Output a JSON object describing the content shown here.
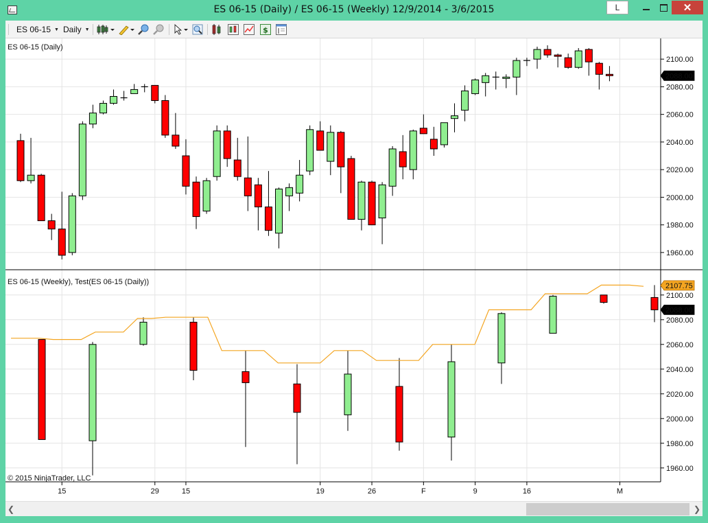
{
  "window": {
    "title": "ES 06-15 (Daily) / ES 06-15 (Weekly)  12/9/2014 - 3/6/2015",
    "l_button": "L",
    "close_glyph": "✕"
  },
  "toolbar": {
    "instrument": "ES 06-15",
    "interval": "Daily",
    "icons": [
      "chart-style-icon",
      "drawing-tool-icon",
      "zoom-in-icon",
      "zoom-out-icon",
      "pointer-icon",
      "magnifier-icon",
      "data-series-icon",
      "indicators-icon",
      "strategies-icon",
      "dollar-icon",
      "properties-icon"
    ]
  },
  "colors": {
    "up": "#90ee90",
    "down": "#ff0000",
    "outline": "#000000",
    "indicator_line": "#f4a521",
    "indicator_label_bg": "#f4a521",
    "last_price_bg": "#000000",
    "grid": "#e4e4e4"
  },
  "chart_data": [
    {
      "type": "candlestick",
      "panel": "top",
      "title": "ES 06-15 (Daily)",
      "y_ticks": [
        1960,
        1980,
        2000,
        2020,
        2040,
        2060,
        2080,
        2100
      ],
      "y_tick_labels": [
        "1960.00",
        "1980.00",
        "2000.00",
        "2020.00",
        "2040.00",
        "2060.00",
        "2080.00",
        "2100.00"
      ],
      "ylim": [
        1951,
        2112
      ],
      "last_price": "2088.00",
      "last_price_value": 2088,
      "grid": true,
      "candles": [
        {
          "o": 2041,
          "h": 2046,
          "l": 2011,
          "c": 2012
        },
        {
          "o": 2012,
          "h": 2043,
          "l": 2010,
          "c": 2016
        },
        {
          "o": 2016,
          "h": 2017,
          "l": 1983,
          "c": 1983
        },
        {
          "o": 1983,
          "h": 1988,
          "l": 1969,
          "c": 1977
        },
        {
          "o": 1977,
          "h": 2004,
          "l": 1955,
          "c": 1958
        },
        {
          "o": 1960,
          "h": 2003,
          "l": 1958,
          "c": 2001
        },
        {
          "o": 2001,
          "h": 2055,
          "l": 1998,
          "c": 2053
        },
        {
          "o": 2053,
          "h": 2067,
          "l": 2050,
          "c": 2061
        },
        {
          "o": 2061,
          "h": 2070,
          "l": 2060,
          "c": 2068
        },
        {
          "o": 2068,
          "h": 2078,
          "l": 2067,
          "c": 2073
        },
        {
          "o": 2072,
          "h": 2077,
          "l": 2070,
          "c": 2072
        },
        {
          "o": 2075,
          "h": 2082,
          "l": 2075,
          "c": 2078
        },
        {
          "o": 2080,
          "h": 2082,
          "l": 2076,
          "c": 2080
        },
        {
          "o": 2081,
          "h": 2081,
          "l": 2068,
          "c": 2070
        },
        {
          "o": 2070,
          "h": 2074,
          "l": 2043,
          "c": 2045
        },
        {
          "o": 2045,
          "h": 2061,
          "l": 2035,
          "c": 2037
        },
        {
          "o": 2030,
          "h": 2042,
          "l": 2002,
          "c": 2008
        },
        {
          "o": 2011,
          "h": 2015,
          "l": 1977,
          "c": 1986
        },
        {
          "o": 1990,
          "h": 2014,
          "l": 1988,
          "c": 2012
        },
        {
          "o": 2015,
          "h": 2052,
          "l": 2012,
          "c": 2048
        },
        {
          "o": 2048,
          "h": 2052,
          "l": 2022,
          "c": 2028
        },
        {
          "o": 2027,
          "h": 2043,
          "l": 2012,
          "c": 2015
        },
        {
          "o": 2014,
          "h": 2044,
          "l": 1990,
          "c": 2001
        },
        {
          "o": 2009,
          "h": 2014,
          "l": 1976,
          "c": 1993
        },
        {
          "o": 1993,
          "h": 2019,
          "l": 1972,
          "c": 1976
        },
        {
          "o": 1974,
          "h": 2007,
          "l": 1963,
          "c": 2006
        },
        {
          "o": 2001,
          "h": 2010,
          "l": 1990,
          "c": 2007
        },
        {
          "o": 2003,
          "h": 2027,
          "l": 1997,
          "c": 2016
        },
        {
          "o": 2019,
          "h": 2052,
          "l": 2016,
          "c": 2049
        },
        {
          "o": 2048,
          "h": 2055,
          "l": 2035,
          "c": 2034
        },
        {
          "o": 2026,
          "h": 2052,
          "l": 2016,
          "c": 2047
        },
        {
          "o": 2047,
          "h": 2048,
          "l": 2003,
          "c": 2022
        },
        {
          "o": 2028,
          "h": 2030,
          "l": 1984,
          "c": 1984
        },
        {
          "o": 1984,
          "h": 2012,
          "l": 1976,
          "c": 2011
        },
        {
          "o": 2011,
          "h": 2012,
          "l": 1980,
          "c": 1980
        },
        {
          "o": 1985,
          "h": 2011,
          "l": 1966,
          "c": 2009
        },
        {
          "o": 2008,
          "h": 2037,
          "l": 2001,
          "c": 2035
        },
        {
          "o": 2033,
          "h": 2045,
          "l": 2013,
          "c": 2022
        },
        {
          "o": 2020,
          "h": 2049,
          "l": 2013,
          "c": 2048
        },
        {
          "o": 2050,
          "h": 2060,
          "l": 2046,
          "c": 2046
        },
        {
          "o": 2042,
          "h": 2051,
          "l": 2030,
          "c": 2035
        },
        {
          "o": 2038,
          "h": 2054,
          "l": 2036,
          "c": 2054
        },
        {
          "o": 2057,
          "h": 2068,
          "l": 2047,
          "c": 2059
        },
        {
          "o": 2063,
          "h": 2081,
          "l": 2055,
          "c": 2077
        },
        {
          "o": 2075,
          "h": 2086,
          "l": 2074,
          "c": 2085
        },
        {
          "o": 2083,
          "h": 2090,
          "l": 2073,
          "c": 2088
        },
        {
          "o": 2087,
          "h": 2091,
          "l": 2078,
          "c": 2087
        },
        {
          "o": 2086,
          "h": 2089,
          "l": 2079,
          "c": 2087
        },
        {
          "o": 2087,
          "h": 2101,
          "l": 2074,
          "c": 2099
        },
        {
          "o": 2099,
          "h": 2101,
          "l": 2095,
          "c": 2099
        },
        {
          "o": 2100,
          "h": 2109,
          "l": 2093,
          "c": 2107
        },
        {
          "o": 2107,
          "h": 2110,
          "l": 2101,
          "c": 2103
        },
        {
          "o": 2103,
          "h": 2104,
          "l": 2094,
          "c": 2102
        },
        {
          "o": 2101,
          "h": 2104,
          "l": 2093,
          "c": 2094
        },
        {
          "o": 2094,
          "h": 2108,
          "l": 2093,
          "c": 2106
        },
        {
          "o": 2107,
          "h": 2108,
          "l": 2088,
          "c": 2098
        },
        {
          "o": 2097,
          "h": 2098,
          "l": 2078,
          "c": 2089
        },
        {
          "o": 2089,
          "h": 2095,
          "l": 2084,
          "c": 2088
        }
      ]
    },
    {
      "type": "candlestick",
      "panel": "bottom",
      "title": "ES 06-15 (Weekly), Test(ES 06-15 (Daily))",
      "y_ticks": [
        1960,
        1980,
        2000,
        2020,
        2040,
        2060,
        2080,
        2100
      ],
      "y_tick_labels": [
        "1960.00",
        "1980.00",
        "2000.00",
        "2020.00",
        "2040.00",
        "2060.00",
        "2080.00",
        "2100.00"
      ],
      "ylim": [
        1951,
        2116
      ],
      "last_price": "2088.00",
      "last_price_value": 2088,
      "indicator_label": "2107.75",
      "indicator_value": 2107.75,
      "grid": true,
      "candles": [
        {
          "o": 2064,
          "h": 2064,
          "l": 1983,
          "c": 1983
        },
        {
          "o": 1982,
          "h": 2062,
          "l": 1954,
          "c": 2060
        },
        {
          "o": 2060,
          "h": 2082,
          "l": 2059,
          "c": 2078
        },
        {
          "o": 2078,
          "h": 2082,
          "l": 2031,
          "c": 2039
        },
        {
          "o": 2038,
          "h": 2055,
          "l": 1977,
          "c": 2029
        },
        {
          "o": 2028,
          "h": 2044,
          "l": 1963,
          "c": 2005
        },
        {
          "o": 2003,
          "h": 2055,
          "l": 1990,
          "c": 2036
        },
        {
          "o": 2026,
          "h": 2049,
          "l": 1974,
          "c": 1981
        },
        {
          "o": 1985,
          "h": 2060,
          "l": 1966,
          "c": 2046
        },
        {
          "o": 2045,
          "h": 2086,
          "l": 2028,
          "c": 2085
        },
        {
          "o": 2069,
          "h": 2100,
          "l": 2074,
          "c": 2099
        },
        {
          "o": 2100,
          "h": 2100,
          "l": 2093,
          "c": 2094
        },
        {
          "o": 2098,
          "h": 2108,
          "l": 2078,
          "c": 2088
        }
      ],
      "indicator_line": [
        2065,
        2065,
        2065,
        2064,
        2064,
        2064,
        2070,
        2070,
        2070,
        2081,
        2081,
        2082,
        2082,
        2082,
        2082,
        2055,
        2055,
        2055,
        2055,
        2045,
        2045,
        2045,
        2045,
        2055,
        2055,
        2055,
        2047,
        2047,
        2047,
        2047,
        2060,
        2060,
        2060,
        2060,
        2088,
        2088,
        2088,
        2088,
        2101,
        2101,
        2101,
        2101,
        2108,
        2108,
        2108,
        2107
      ]
    }
  ],
  "x_axis": {
    "tick_labels": [
      "15",
      "29",
      "15",
      "19",
      "26",
      "F",
      "9",
      "16",
      "M"
    ],
    "tick_day_index": [
      4,
      13,
      16,
      29,
      34,
      39,
      44,
      49,
      58
    ]
  },
  "copyright": "© 2015 NinjaTrader, LLC"
}
